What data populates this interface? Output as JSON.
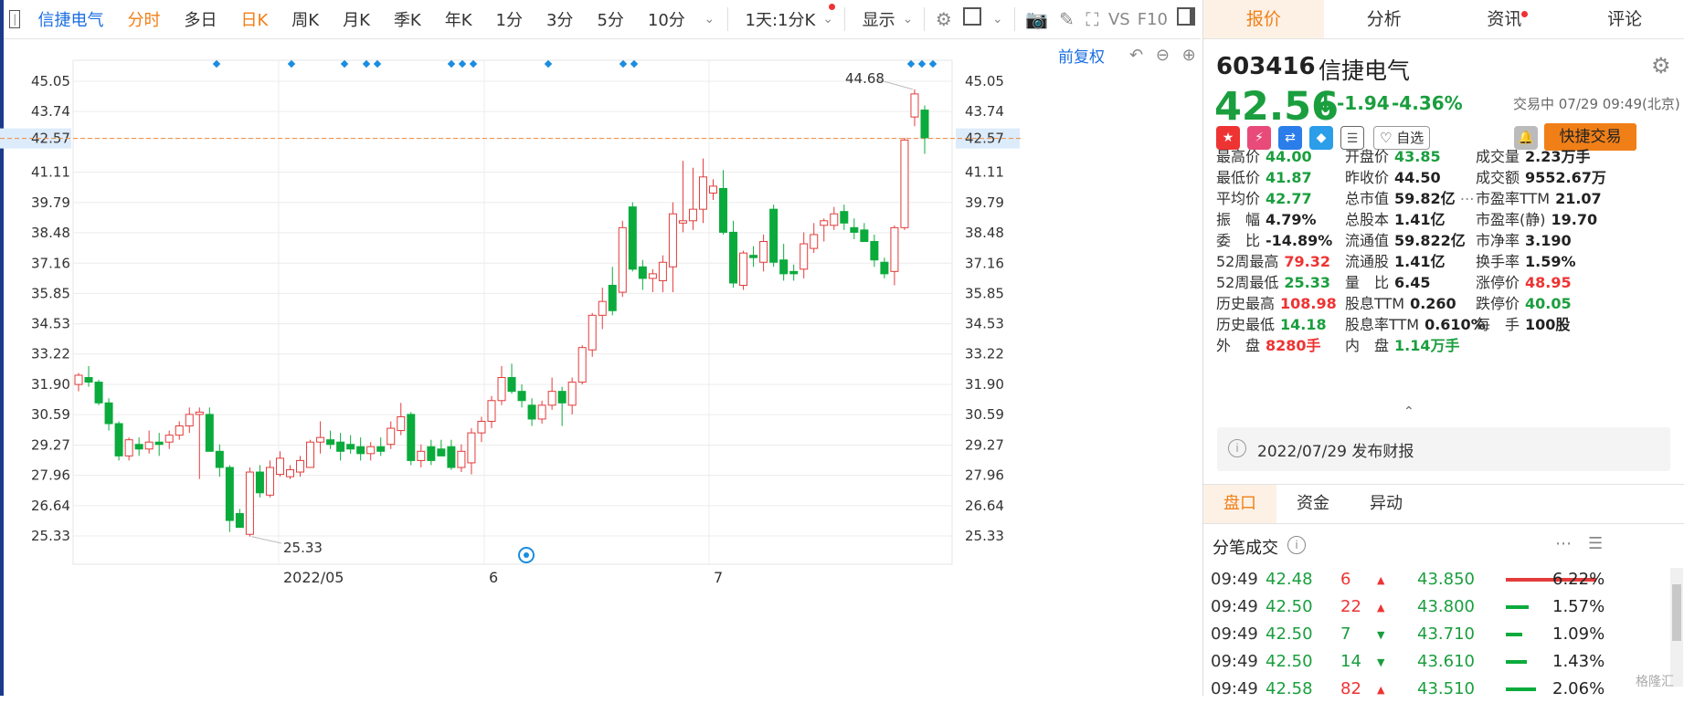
{
  "toolbar": {
    "stock_name": "信捷电气",
    "items": [
      "分时",
      "多日",
      "日K",
      "周K",
      "月K",
      "季K",
      "年K",
      "1分",
      "3分",
      "5分",
      "10分"
    ],
    "period_select": "1天:1分K",
    "display_label": "显示",
    "vs_label": "VS",
    "f10_label": "F10"
  },
  "chart": {
    "fuquan_label": "前复权",
    "y_ticks": [
      "45.05",
      "43.74",
      "42.57",
      "41.11",
      "39.79",
      "38.48",
      "37.16",
      "35.85",
      "34.53",
      "33.22",
      "31.90",
      "30.59",
      "29.27",
      "27.96",
      "26.64",
      "25.33"
    ],
    "x_labels": [
      "2022/05",
      "6",
      "7"
    ],
    "high_label": "44.68",
    "low_label": "25.33",
    "current_price_label": "42.57",
    "colors": {
      "up": "#e33b3b",
      "down": "#0aab3c",
      "grid": "#ececec",
      "dashline": "#f08a3a",
      "marker": "#1a8de0"
    }
  },
  "chart_data": {
    "type": "candlestick",
    "ylim": [
      25.33,
      45.05
    ],
    "candles": [
      [
        31.9,
        32.4,
        31.6,
        32.3
      ],
      [
        32.2,
        32.7,
        31.8,
        32.0
      ],
      [
        32.0,
        32.1,
        31.0,
        31.1
      ],
      [
        31.1,
        31.3,
        29.9,
        30.2
      ],
      [
        30.2,
        30.3,
        28.6,
        28.8
      ],
      [
        28.8,
        29.6,
        28.6,
        29.5
      ],
      [
        29.3,
        29.6,
        28.8,
        29.1
      ],
      [
        29.1,
        29.9,
        28.9,
        29.4
      ],
      [
        29.4,
        29.8,
        28.8,
        29.3
      ],
      [
        29.4,
        29.9,
        29.1,
        29.7
      ],
      [
        29.7,
        30.3,
        29.5,
        30.1
      ],
      [
        30.1,
        30.9,
        29.8,
        30.6
      ],
      [
        30.6,
        30.9,
        27.8,
        30.7
      ],
      [
        30.6,
        30.9,
        29.0,
        29.0
      ],
      [
        29.0,
        29.3,
        27.9,
        28.3
      ],
      [
        28.3,
        28.4,
        25.5,
        26.0
      ],
      [
        26.3,
        26.5,
        25.8,
        25.7
      ],
      [
        25.4,
        28.3,
        25.3,
        28.1
      ],
      [
        28.1,
        28.4,
        27.0,
        27.2
      ],
      [
        27.1,
        28.6,
        27.0,
        28.3
      ],
      [
        28.0,
        29.0,
        27.9,
        28.7
      ],
      [
        27.9,
        28.4,
        27.8,
        28.2
      ],
      [
        28.1,
        28.8,
        27.9,
        28.6
      ],
      [
        28.3,
        29.5,
        28.3,
        29.4
      ],
      [
        29.4,
        30.3,
        28.9,
        29.6
      ],
      [
        29.5,
        29.9,
        29.1,
        29.3
      ],
      [
        29.4,
        29.8,
        28.6,
        29.0
      ],
      [
        29.3,
        29.7,
        28.9,
        29.1
      ],
      [
        29.2,
        29.6,
        28.6,
        28.9
      ],
      [
        28.9,
        29.4,
        28.6,
        29.2
      ],
      [
        29.2,
        29.6,
        28.8,
        29.0
      ],
      [
        29.3,
        30.3,
        29.1,
        30.0
      ],
      [
        29.9,
        31.1,
        29.7,
        30.5
      ],
      [
        30.6,
        30.7,
        28.4,
        28.6
      ],
      [
        28.6,
        29.3,
        28.3,
        29.0
      ],
      [
        29.2,
        29.5,
        28.4,
        28.6
      ],
      [
        29.1,
        29.5,
        28.8,
        28.8
      ],
      [
        29.2,
        29.5,
        28.2,
        28.3
      ],
      [
        28.3,
        29.3,
        28.1,
        29.0
      ],
      [
        28.5,
        30.0,
        28.0,
        29.8
      ],
      [
        29.8,
        30.5,
        29.4,
        30.3
      ],
      [
        30.3,
        31.4,
        30.0,
        31.2
      ],
      [
        31.2,
        32.7,
        31.0,
        32.2
      ],
      [
        32.2,
        32.8,
        31.5,
        31.6
      ],
      [
        31.6,
        31.9,
        30.9,
        31.2
      ],
      [
        31.0,
        31.3,
        30.1,
        30.4
      ],
      [
        30.4,
        31.2,
        30.2,
        31.0
      ],
      [
        31.0,
        32.2,
        30.8,
        31.6
      ],
      [
        31.6,
        31.8,
        30.1,
        31.1
      ],
      [
        31.0,
        32.2,
        30.6,
        32.0
      ],
      [
        32.0,
        33.6,
        31.9,
        33.5
      ],
      [
        33.4,
        35.0,
        33.1,
        34.9
      ],
      [
        34.9,
        36.1,
        34.3,
        35.5
      ],
      [
        36.2,
        37.0,
        34.9,
        35.1
      ],
      [
        35.9,
        39.0,
        35.7,
        38.7
      ],
      [
        39.6,
        39.8,
        36.8,
        36.9
      ],
      [
        37.0,
        37.3,
        36.0,
        36.5
      ],
      [
        36.5,
        36.9,
        35.9,
        36.7
      ],
      [
        36.4,
        37.5,
        35.9,
        37.2
      ],
      [
        37.0,
        39.8,
        35.9,
        39.3
      ],
      [
        38.9,
        41.6,
        38.5,
        39.0
      ],
      [
        39.0,
        41.3,
        38.6,
        39.5
      ],
      [
        39.5,
        41.7,
        38.9,
        40.9
      ],
      [
        40.2,
        40.8,
        39.9,
        40.5
      ],
      [
        40.4,
        41.2,
        38.4,
        38.5
      ],
      [
        38.5,
        39.0,
        36.1,
        36.3
      ],
      [
        36.2,
        37.7,
        36.0,
        37.6
      ],
      [
        37.5,
        37.9,
        37.0,
        37.4
      ],
      [
        37.2,
        38.4,
        36.8,
        38.1
      ],
      [
        39.5,
        39.7,
        37.0,
        37.2
      ],
      [
        37.3,
        38.0,
        36.4,
        36.7
      ],
      [
        36.8,
        37.1,
        36.4,
        36.7
      ],
      [
        36.9,
        38.5,
        36.5,
        38.0
      ],
      [
        37.8,
        38.9,
        37.6,
        38.4
      ],
      [
        38.8,
        39.1,
        38.1,
        39.0
      ],
      [
        38.8,
        39.6,
        38.6,
        39.3
      ],
      [
        39.4,
        39.7,
        38.6,
        38.9
      ],
      [
        38.7,
        39.1,
        38.2,
        38.5
      ],
      [
        38.6,
        38.9,
        38.1,
        38.1
      ],
      [
        38.1,
        38.4,
        37.0,
        37.3
      ],
      [
        37.2,
        37.4,
        36.5,
        36.7
      ],
      [
        36.8,
        38.8,
        36.2,
        38.7
      ],
      [
        38.7,
        42.6,
        38.6,
        42.5
      ],
      [
        43.5,
        44.7,
        43.1,
        44.5
      ],
      [
        43.8,
        44.0,
        41.9,
        42.6
      ]
    ],
    "markers_count": 14
  },
  "quote": {
    "tabs": [
      "报价",
      "分析",
      "资讯",
      "评论"
    ],
    "code": "603416",
    "name": "信捷电气",
    "price": "42.56",
    "change": "-1.94",
    "change_pct": "-4.36%",
    "trade_status": "交易中 07/29 09:49(北京)",
    "watch_label": "自选",
    "quick_trade": "快捷交易",
    "stats": [
      {
        "k": "最高价",
        "v": "44.00",
        "c": "green"
      },
      {
        "k": "开盘价",
        "v": "43.85",
        "c": "green"
      },
      {
        "k": "成交量",
        "v": "2.23万手",
        "c": "black"
      },
      {
        "k": "最低价",
        "v": "41.87",
        "c": "green"
      },
      {
        "k": "昨收价",
        "v": "44.50",
        "c": "black"
      },
      {
        "k": "成交额",
        "v": "9552.67万",
        "c": "black"
      },
      {
        "k": "平均价",
        "v": "42.77",
        "c": "green"
      },
      {
        "k": "总市值",
        "v": "59.82亿",
        "c": "black"
      },
      {
        "k": "市盈率TTM",
        "v": "21.07",
        "c": "black"
      },
      {
        "k": "振　幅",
        "v": "4.79%",
        "c": "black"
      },
      {
        "k": "总股本",
        "v": "1.41亿",
        "c": "black"
      },
      {
        "k": "市盈率(静)",
        "v": "19.70",
        "c": "black"
      },
      {
        "k": "委　比",
        "v": "-14.89%",
        "c": "black"
      },
      {
        "k": "流通值",
        "v": "59.822亿",
        "c": "black"
      },
      {
        "k": "市净率",
        "v": "3.190",
        "c": "black"
      },
      {
        "k": "52周最高",
        "v": "79.32",
        "c": "red"
      },
      {
        "k": "流通股",
        "v": "1.41亿",
        "c": "black"
      },
      {
        "k": "换手率",
        "v": "1.59%",
        "c": "black"
      },
      {
        "k": "52周最低",
        "v": "25.33",
        "c": "green"
      },
      {
        "k": "量　比",
        "v": "6.45",
        "c": "black"
      },
      {
        "k": "涨停价",
        "v": "48.95",
        "c": "red"
      },
      {
        "k": "历史最高",
        "v": "108.98",
        "c": "red"
      },
      {
        "k": "股息TTM",
        "v": "0.260",
        "c": "black"
      },
      {
        "k": "跌停价",
        "v": "40.05",
        "c": "green"
      },
      {
        "k": "历史最低",
        "v": "14.18",
        "c": "green"
      },
      {
        "k": "股息率TTM",
        "v": "0.610%",
        "c": "black"
      },
      {
        "k": "每　手",
        "v": "100股",
        "c": "black"
      },
      {
        "k": "外　盘",
        "v": "8280手",
        "c": "red"
      },
      {
        "k": "内　盘",
        "v": "1.14万手",
        "c": "green"
      }
    ],
    "report": "2022/07/29  发布财报",
    "subtabs": [
      "盘口",
      "资金",
      "异动"
    ],
    "tick_title": "分笔成交",
    "ticks": [
      {
        "time": "09:49",
        "price": "42.48",
        "vol": "6",
        "dir": "up",
        "p2": "43.850",
        "pct": "6.22%",
        "frac": 0.99,
        "barc": "#e33b3b"
      },
      {
        "time": "09:49",
        "price": "42.50",
        "vol": "22",
        "dir": "up",
        "p2": "43.800",
        "pct": "1.57%",
        "frac": 0.25,
        "barc": "#0aab3c"
      },
      {
        "time": "09:49",
        "price": "42.50",
        "vol": "7",
        "dir": "down",
        "p2": "43.710",
        "pct": "1.09%",
        "frac": 0.18,
        "barc": "#0aab3c"
      },
      {
        "time": "09:49",
        "price": "42.50",
        "vol": "14",
        "dir": "down",
        "p2": "43.610",
        "pct": "1.43%",
        "frac": 0.23,
        "barc": "#0aab3c"
      },
      {
        "time": "09:49",
        "price": "42.58",
        "vol": "82",
        "dir": "up",
        "p2": "43.510",
        "pct": "2.06%",
        "frac": 0.33,
        "barc": "#0aab3c"
      }
    ],
    "watermark": "格隆汇"
  }
}
